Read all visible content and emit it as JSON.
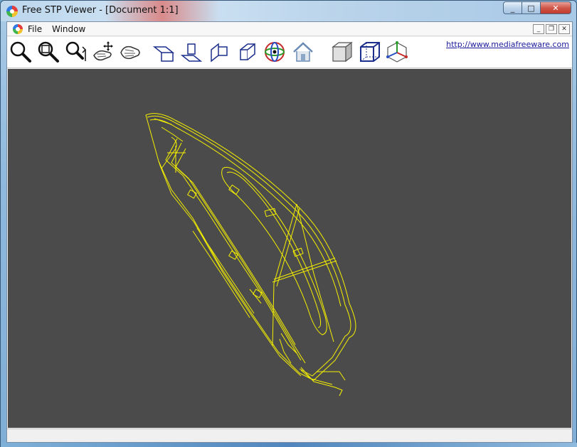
{
  "window": {
    "title": "Free STP Viewer - [Document 1:1]",
    "controls": {
      "minimize": "_",
      "maximize": "□",
      "close": "✕"
    }
  },
  "menubar": {
    "items": [
      {
        "label": "File"
      },
      {
        "label": "Window"
      }
    ],
    "mdi_controls": {
      "minimize": "_",
      "restore": "❐",
      "close": "✕"
    }
  },
  "toolbar": {
    "buttons": [
      {
        "icon": "zoom-icon"
      },
      {
        "icon": "zoom-window-icon"
      },
      {
        "icon": "zoom-dynamic-icon"
      },
      {
        "icon": "pan-icon"
      },
      {
        "icon": "rotate-icon"
      },
      {
        "icon": "view-top-icon"
      },
      {
        "icon": "view-front-icon"
      },
      {
        "icon": "view-side-icon"
      },
      {
        "icon": "view-right-icon"
      },
      {
        "icon": "view-orbit-icon"
      },
      {
        "icon": "home-view-icon"
      },
      {
        "icon": "shaded-mode-icon"
      },
      {
        "icon": "wireframe-mode-icon"
      },
      {
        "icon": "axes-icon"
      }
    ],
    "link_text": "http://www.mediafreeware.com"
  },
  "viewport": {
    "background_color": "#4b4b4b",
    "wireframe_color": "#f5f000"
  },
  "statusbar": {
    "text": ""
  }
}
